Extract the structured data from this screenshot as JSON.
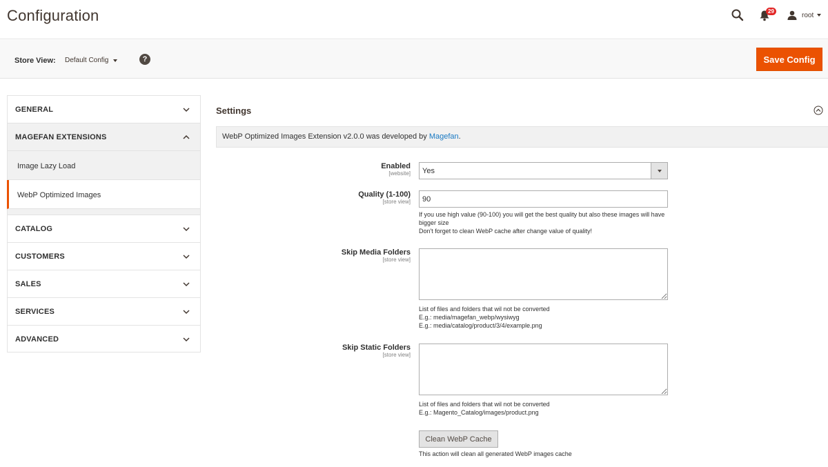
{
  "header": {
    "title": "Configuration",
    "notifications_count": "29",
    "user_name": "root"
  },
  "toolbar": {
    "store_view_label": "Store View:",
    "store_view_value": "Default Config",
    "help": "?",
    "save_label": "Save Config"
  },
  "sidebar": {
    "sections": [
      {
        "label": "GENERAL"
      },
      {
        "label": "MAGEFAN EXTENSIONS"
      },
      {
        "label": "CATALOG"
      },
      {
        "label": "CUSTOMERS"
      },
      {
        "label": "SALES"
      },
      {
        "label": "SERVICES"
      },
      {
        "label": "ADVANCED"
      }
    ],
    "sub_items": [
      {
        "label": "Image Lazy Load"
      },
      {
        "label": "WebP Optimized Images"
      }
    ]
  },
  "main": {
    "section_title": "Settings",
    "info_text": "WebP Optimized Images Extension v2.0.0 was developed by ",
    "info_link": "Magefan",
    "info_suffix": ".",
    "fields": {
      "enabled": {
        "label": "Enabled",
        "scope": "[website]",
        "value": "Yes"
      },
      "quality": {
        "label": "Quality (1-100)",
        "scope": "[store view]",
        "value": "90",
        "note_1": "If you use high value (90-100) you will get the best quality but also these images will have bigger size",
        "note_2": "Don't forget to clean WebP cache after change value of quality!"
      },
      "skip_media": {
        "label": "Skip Media Folders",
        "scope": "[store view]",
        "note_1": "List of files and folders that wil not be converted",
        "note_2": "E.g.: media/magefan_webp/wysiwyg",
        "note_3": "E.g.: media/catalog/product/3/4/example.png"
      },
      "skip_static": {
        "label": "Skip Static Folders",
        "scope": "[store view]",
        "note_1": "List of files and folders that wil not be converted",
        "note_2": "E.g.: Magento_Catalog/images/product.png"
      }
    },
    "clean_button": "Clean WebP Cache",
    "clean_note": "This action will clean all generated WebP images cache"
  },
  "colors": {
    "accent": "#eb5202",
    "link": "#1979c3",
    "badge": "#e22626"
  }
}
